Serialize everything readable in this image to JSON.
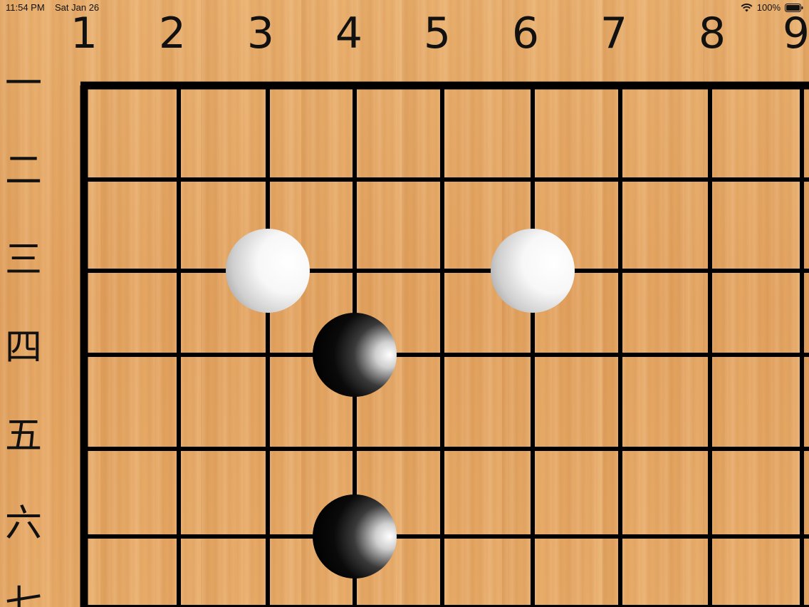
{
  "status_bar": {
    "time": "11:54 PM",
    "date": "Sat Jan 26",
    "battery": "100%",
    "wifi_icon": "wifi-icon",
    "battery_icon": "battery-icon"
  },
  "board": {
    "column_labels": [
      "1",
      "2",
      "3",
      "4",
      "5",
      "6",
      "7",
      "8",
      "9"
    ],
    "row_labels": [
      "一",
      "二",
      "三",
      "四",
      "五",
      "六",
      "七"
    ],
    "stones": [
      {
        "color": "white",
        "col": 3,
        "row": 3
      },
      {
        "color": "white",
        "col": 6,
        "row": 3
      },
      {
        "color": "black",
        "col": 4,
        "row": 4
      },
      {
        "color": "black",
        "col": 4,
        "row": 6
      }
    ],
    "colors": {
      "board": "#e6a865",
      "line": "#000000",
      "black_stone": "#000000",
      "white_stone": "#ffffff"
    }
  }
}
